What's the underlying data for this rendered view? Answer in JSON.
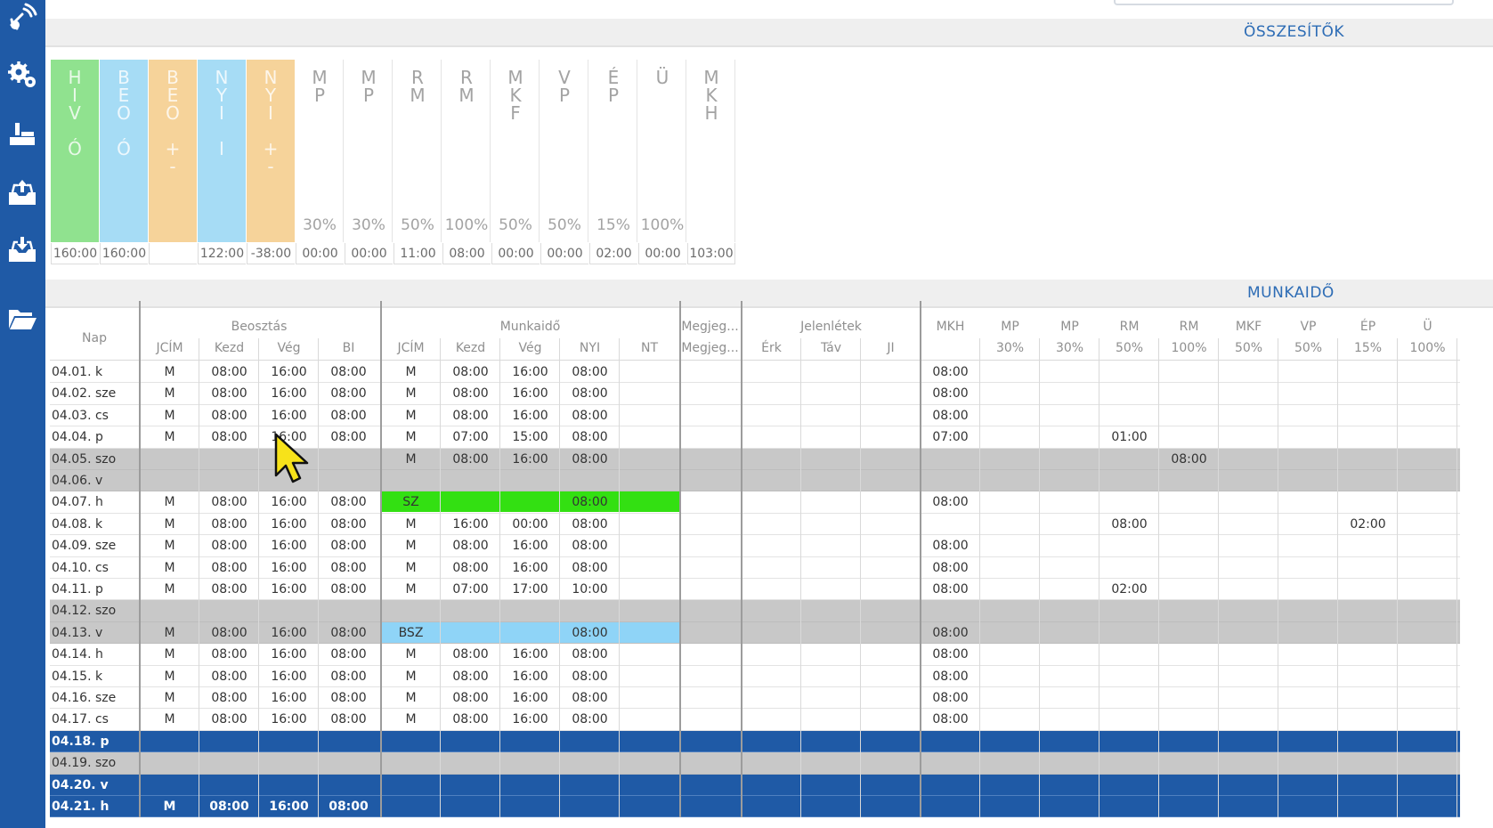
{
  "sidebar": {
    "icons": [
      "satellite-icon",
      "settings-gears-icon",
      "factory-icon",
      "inbox-upload-icon",
      "inbox-download-icon",
      "folder-open-icon"
    ]
  },
  "sections": {
    "summary_title": "ÖSSZESÍTŐK",
    "worktime_title": "MUNKAIDŐ"
  },
  "colors": {
    "sidebar": "#1f5aa6",
    "green": "#90e28f",
    "light_blue": "#a6dcf5",
    "orange": "#f6d39a",
    "weekend": "#c8c8c8",
    "selected": "#1f5aa6",
    "sz_highlight": "#33e012",
    "bsz_highlight": "#8fd4f7",
    "header_text": "#2d6cb5"
  },
  "summary": {
    "columns": [
      {
        "code": "H\nI\nV\n\nÓ",
        "pct": "",
        "value": "160:00",
        "color": "green"
      },
      {
        "code": "B\nE\nO\n\nÓ",
        "pct": "",
        "value": "160:00",
        "color": "light_blue"
      },
      {
        "code": "B\nE\nO\n\n+\n-",
        "pct": "",
        "value": "",
        "color": "orange"
      },
      {
        "code": "N\nY\nI\n\nI",
        "pct": "",
        "value": "122:00",
        "color": "light_blue"
      },
      {
        "code": "N\nY\nI\n\n+\n-",
        "pct": "",
        "value": "-38:00",
        "color": "orange"
      },
      {
        "code": "M\nP",
        "pct": "30%",
        "value": "00:00",
        "color": ""
      },
      {
        "code": "M\nP",
        "pct": "30%",
        "value": "00:00",
        "color": ""
      },
      {
        "code": "R\nM",
        "pct": "50%",
        "value": "11:00",
        "color": ""
      },
      {
        "code": "R\nM",
        "pct": "100%",
        "value": "08:00",
        "color": ""
      },
      {
        "code": "M\nK\nF",
        "pct": "50%",
        "value": "00:00",
        "color": ""
      },
      {
        "code": "V\nP",
        "pct": "50%",
        "value": "00:00",
        "color": ""
      },
      {
        "code": "É\nP",
        "pct": "15%",
        "value": "02:00",
        "color": ""
      },
      {
        "code": "Ü",
        "pct": "100%",
        "value": "00:00",
        "color": ""
      },
      {
        "code": "M\nK\nH",
        "pct": "",
        "value": "103:00",
        "color": ""
      }
    ]
  },
  "grid": {
    "groups": {
      "nap": "Nap",
      "beosztas": "Beosztás",
      "munkaido": "Munkaidő",
      "megjegy": "Megjeg...",
      "jelenletek": "Jelenlétek"
    },
    "subheaders": [
      "JCÍM",
      "Kezd",
      "Vég",
      "BI",
      "JCÍM",
      "Kezd",
      "Vég",
      "NYI",
      "NT",
      "Megjeg...",
      "Érk",
      "Táv",
      "JI"
    ],
    "right_headers": [
      {
        "top": "MKH",
        "bottom": ""
      },
      {
        "top": "MP",
        "bottom": "30%"
      },
      {
        "top": "MP",
        "bottom": "30%"
      },
      {
        "top": "RM",
        "bottom": "50%"
      },
      {
        "top": "RM",
        "bottom": "100%"
      },
      {
        "top": "MKF",
        "bottom": "50%"
      },
      {
        "top": "VP",
        "bottom": "50%"
      },
      {
        "top": "ÉP",
        "bottom": "15%"
      },
      {
        "top": "Ü",
        "bottom": "100%"
      }
    ],
    "rows": [
      {
        "date": "04.01. k",
        "type": "normal",
        "cells": [
          "M",
          "08:00",
          "16:00",
          "08:00",
          "M",
          "08:00",
          "16:00",
          "08:00",
          "",
          "",
          "",
          "",
          "",
          "08:00",
          "",
          "",
          "",
          "",
          "",
          "",
          "",
          ""
        ]
      },
      {
        "date": "04.02. sze",
        "type": "normal",
        "cells": [
          "M",
          "08:00",
          "16:00",
          "08:00",
          "M",
          "08:00",
          "16:00",
          "08:00",
          "",
          "",
          "",
          "",
          "",
          "08:00",
          "",
          "",
          "",
          "",
          "",
          "",
          "",
          ""
        ]
      },
      {
        "date": "04.03. cs",
        "type": "normal",
        "cells": [
          "M",
          "08:00",
          "16:00",
          "08:00",
          "M",
          "08:00",
          "16:00",
          "08:00",
          "",
          "",
          "",
          "",
          "",
          "08:00",
          "",
          "",
          "",
          "",
          "",
          "",
          "",
          ""
        ]
      },
      {
        "date": "04.04. p",
        "type": "normal",
        "cells": [
          "M",
          "08:00",
          "16:00",
          "08:00",
          "M",
          "07:00",
          "15:00",
          "08:00",
          "",
          "",
          "",
          "",
          "",
          "07:00",
          "",
          "",
          "01:00",
          "",
          "",
          "",
          "",
          ""
        ]
      },
      {
        "date": "04.05. szo",
        "type": "weekend",
        "cells": [
          "",
          "",
          "",
          "",
          "M",
          "08:00",
          "16:00",
          "08:00",
          "",
          "",
          "",
          "",
          "",
          "",
          "",
          "",
          "",
          "08:00",
          "",
          "",
          "",
          ""
        ]
      },
      {
        "date": "04.06. v",
        "type": "weekend",
        "cells": [
          "",
          "",
          "",
          "",
          "",
          "",
          "",
          "",
          "",
          "",
          "",
          "",
          "",
          "",
          "",
          "",
          "",
          "",
          "",
          "",
          "",
          ""
        ]
      },
      {
        "date": "04.07. h",
        "type": "normal",
        "highlight": "sz_highlight",
        "cells": [
          "M",
          "08:00",
          "16:00",
          "08:00",
          "SZ",
          "",
          "",
          "08:00",
          "",
          "",
          "",
          "",
          "",
          "08:00",
          "",
          "",
          "",
          "",
          "",
          "",
          "",
          ""
        ]
      },
      {
        "date": "04.08. k",
        "type": "normal",
        "cells": [
          "M",
          "08:00",
          "16:00",
          "08:00",
          "M",
          "16:00",
          "00:00",
          "08:00",
          "",
          "",
          "",
          "",
          "",
          "",
          "",
          "",
          "08:00",
          "",
          "",
          "",
          "02:00",
          ""
        ]
      },
      {
        "date": "04.09. sze",
        "type": "normal",
        "cells": [
          "M",
          "08:00",
          "16:00",
          "08:00",
          "M",
          "08:00",
          "16:00",
          "08:00",
          "",
          "",
          "",
          "",
          "",
          "08:00",
          "",
          "",
          "",
          "",
          "",
          "",
          "",
          ""
        ]
      },
      {
        "date": "04.10. cs",
        "type": "normal",
        "cells": [
          "M",
          "08:00",
          "16:00",
          "08:00",
          "M",
          "08:00",
          "16:00",
          "08:00",
          "",
          "",
          "",
          "",
          "",
          "08:00",
          "",
          "",
          "",
          "",
          "",
          "",
          "",
          ""
        ]
      },
      {
        "date": "04.11. p",
        "type": "normal",
        "cells": [
          "M",
          "08:00",
          "16:00",
          "08:00",
          "M",
          "07:00",
          "17:00",
          "10:00",
          "",
          "",
          "",
          "",
          "",
          "08:00",
          "",
          "",
          "02:00",
          "",
          "",
          "",
          "",
          ""
        ]
      },
      {
        "date": "04.12. szo",
        "type": "weekend",
        "cells": [
          "",
          "",
          "",
          "",
          "",
          "",
          "",
          "",
          "",
          "",
          "",
          "",
          "",
          "",
          "",
          "",
          "",
          "",
          "",
          "",
          "",
          ""
        ]
      },
      {
        "date": "04.13. v",
        "type": "weekend",
        "highlight": "bsz_highlight",
        "cells": [
          "M",
          "08:00",
          "16:00",
          "08:00",
          "BSZ",
          "",
          "",
          "08:00",
          "",
          "",
          "",
          "",
          "",
          "08:00",
          "",
          "",
          "",
          "",
          "",
          "",
          "",
          ""
        ]
      },
      {
        "date": "04.14. h",
        "type": "normal",
        "cells": [
          "M",
          "08:00",
          "16:00",
          "08:00",
          "M",
          "08:00",
          "16:00",
          "08:00",
          "",
          "",
          "",
          "",
          "",
          "08:00",
          "",
          "",
          "",
          "",
          "",
          "",
          "",
          ""
        ]
      },
      {
        "date": "04.15. k",
        "type": "normal",
        "cells": [
          "M",
          "08:00",
          "16:00",
          "08:00",
          "M",
          "08:00",
          "16:00",
          "08:00",
          "",
          "",
          "",
          "",
          "",
          "08:00",
          "",
          "",
          "",
          "",
          "",
          "",
          "",
          ""
        ]
      },
      {
        "date": "04.16. sze",
        "type": "normal",
        "cells": [
          "M",
          "08:00",
          "16:00",
          "08:00",
          "M",
          "08:00",
          "16:00",
          "08:00",
          "",
          "",
          "",
          "",
          "",
          "08:00",
          "",
          "",
          "",
          "",
          "",
          "",
          "",
          ""
        ]
      },
      {
        "date": "04.17. cs",
        "type": "normal",
        "cells": [
          "M",
          "08:00",
          "16:00",
          "08:00",
          "M",
          "08:00",
          "16:00",
          "08:00",
          "",
          "",
          "",
          "",
          "",
          "08:00",
          "",
          "",
          "",
          "",
          "",
          "",
          "",
          ""
        ]
      },
      {
        "date": "04.18. p",
        "type": "selected",
        "cells": [
          "",
          "",
          "",
          "",
          "",
          "",
          "",
          "",
          "",
          "",
          "",
          "",
          "",
          "",
          "",
          "",
          "",
          "",
          "",
          "",
          "",
          ""
        ]
      },
      {
        "date": "04.19. szo",
        "type": "weekend",
        "cells": [
          "",
          "",
          "",
          "",
          "",
          "",
          "",
          "",
          "",
          "",
          "",
          "",
          "",
          "",
          "",
          "",
          "",
          "",
          "",
          "",
          "",
          ""
        ]
      },
      {
        "date": "04.20. v",
        "type": "selected",
        "cells": [
          "",
          "",
          "",
          "",
          "",
          "",
          "",
          "",
          "",
          "",
          "",
          "",
          "",
          "",
          "",
          "",
          "",
          "",
          "",
          "",
          "",
          ""
        ]
      },
      {
        "date": "04.21. h",
        "type": "selected",
        "cells": [
          "M",
          "08:00",
          "16:00",
          "08:00",
          "",
          "",
          "",
          "",
          "",
          "",
          "",
          "",
          "",
          "",
          "",
          "",
          "",
          "",
          "",
          "",
          "",
          ""
        ]
      }
    ]
  }
}
